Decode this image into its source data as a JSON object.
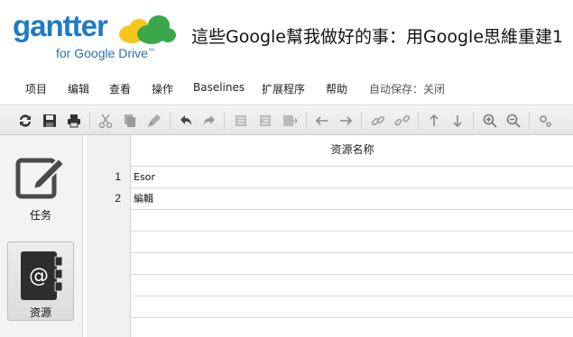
{
  "header": {
    "logo_word": "gantter",
    "logo_sub": "for Google Drive",
    "logo_tm": "™",
    "doc_title": "這些Google幫我做好的事：用Google思維重建1"
  },
  "menu": {
    "items": [
      "项目",
      "编辑",
      "查看",
      "操作",
      "Baselines",
      "扩展程序",
      "帮助"
    ],
    "autosave": "自动保存：关闭"
  },
  "toolbar": {
    "icons": [
      "refresh-icon",
      "save-icon",
      "print-icon",
      "cut-icon",
      "copy-icon",
      "format-painter-icon",
      "undo-icon",
      "redo-icon",
      "indent-icon",
      "outdent-icon",
      "insert-row-icon",
      "arrow-left-icon",
      "arrow-right-icon",
      "link-icon",
      "unlink-icon",
      "arrow-up-icon",
      "arrow-down-icon",
      "zoom-in-icon",
      "zoom-out-icon",
      "settings-icon"
    ]
  },
  "side": {
    "tasks_label": "任务",
    "resources_label": "资源"
  },
  "grid": {
    "column_header": "资源名称",
    "rows": [
      {
        "num": "1",
        "name": "Esor",
        "warning": false
      },
      {
        "num": "2",
        "name": "編輯",
        "warning": true
      },
      {
        "num": "",
        "name": "",
        "warning": false
      },
      {
        "num": "",
        "name": "",
        "warning": false
      },
      {
        "num": "",
        "name": "",
        "warning": false
      },
      {
        "num": "",
        "name": "",
        "warning": false
      },
      {
        "num": "",
        "name": "",
        "warning": false
      },
      {
        "num": "",
        "name": "",
        "warning": false
      }
    ]
  },
  "colors": {
    "brand_blue": "#1f7bc4",
    "cloud_yellow": "#f6c61a",
    "cloud_green": "#3aa84a",
    "warning_yellow": "#f2c200"
  }
}
